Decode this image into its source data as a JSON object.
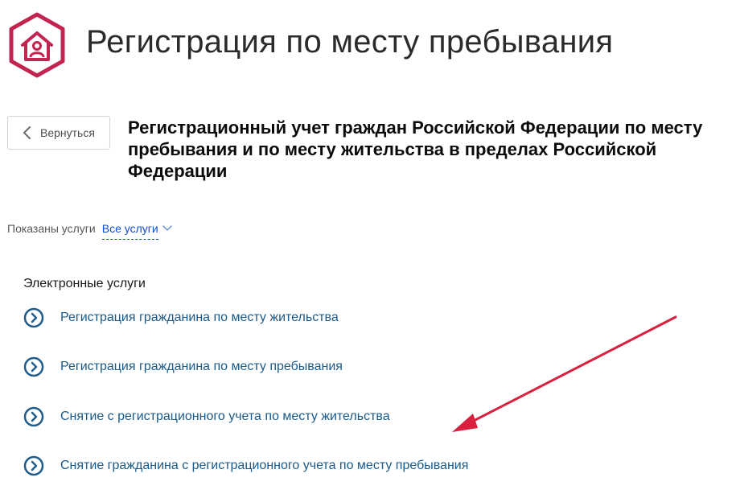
{
  "header": {
    "title": "Регистрация по месту пребывания",
    "logo_icon": "house-person-icon",
    "brand_color": "#c1244f"
  },
  "back_button": {
    "label": "Вернуться",
    "icon": "chevron-left-icon"
  },
  "service": {
    "title": "Регистрационный учет граждан Российской Федерации по месту пребывания и по месту жительства в пределах Российской Федерации"
  },
  "filter": {
    "label": "Показаны услуги",
    "value": "Все услуги",
    "icon": "chevron-down-icon"
  },
  "services_section": {
    "heading": "Электронные услуги",
    "items": [
      {
        "label": "Регистрация гражданина по месту жительства",
        "icon": "chevron-circle-icon"
      },
      {
        "label": "Регистрация гражданина по месту пребывания",
        "icon": "chevron-circle-icon"
      },
      {
        "label": "Снятие с регистрационного учета по месту жительства",
        "icon": "chevron-circle-icon"
      },
      {
        "label": "Снятие гражданина с регистрационного учета по месту пребывания",
        "icon": "chevron-circle-icon"
      }
    ]
  },
  "colors": {
    "link": "#1a5a8a",
    "icon": "#1f5c8c",
    "annotation_arrow": "#d9213e"
  }
}
